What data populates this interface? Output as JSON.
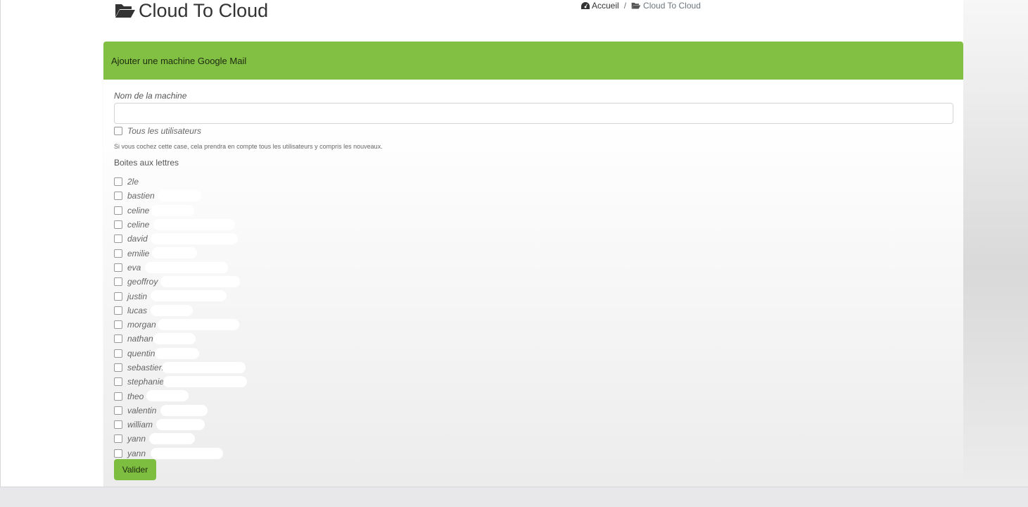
{
  "page": {
    "title": "Cloud To Cloud"
  },
  "breadcrumb": {
    "home": "Accueil",
    "separator": "/",
    "current": "Cloud To Cloud"
  },
  "card": {
    "header": "Ajouter une machine Google Mail",
    "machine_name_label": "Nom de la machine",
    "machine_name_value": "",
    "all_users_label": "Tous les utilisateurs",
    "all_users_help": "Si vous cochez cette case, cela prendra en compte tous les utilisateurs y compris les nouveaux.",
    "mailboxes_label": "Boites aux lettres",
    "mailboxes": [
      {
        "label": "2le"
      },
      {
        "label": "bastien"
      },
      {
        "label": "celine"
      },
      {
        "label": "celine"
      },
      {
        "label": "david"
      },
      {
        "label": "emilie"
      },
      {
        "label": "eva"
      },
      {
        "label": "geoffroy"
      },
      {
        "label": "justin"
      },
      {
        "label": "lucas"
      },
      {
        "label": "morgan"
      },
      {
        "label": "nathan"
      },
      {
        "label": "quentin"
      },
      {
        "label": "sebastien"
      },
      {
        "label": "stephanie"
      },
      {
        "label": "theo"
      },
      {
        "label": "valentin"
      },
      {
        "label": "william"
      },
      {
        "label": "yann"
      },
      {
        "label": "yann"
      }
    ],
    "submit_label": "Valider"
  },
  "colors": {
    "header_green": "#82c043",
    "button_green": "#7dbd3f"
  }
}
